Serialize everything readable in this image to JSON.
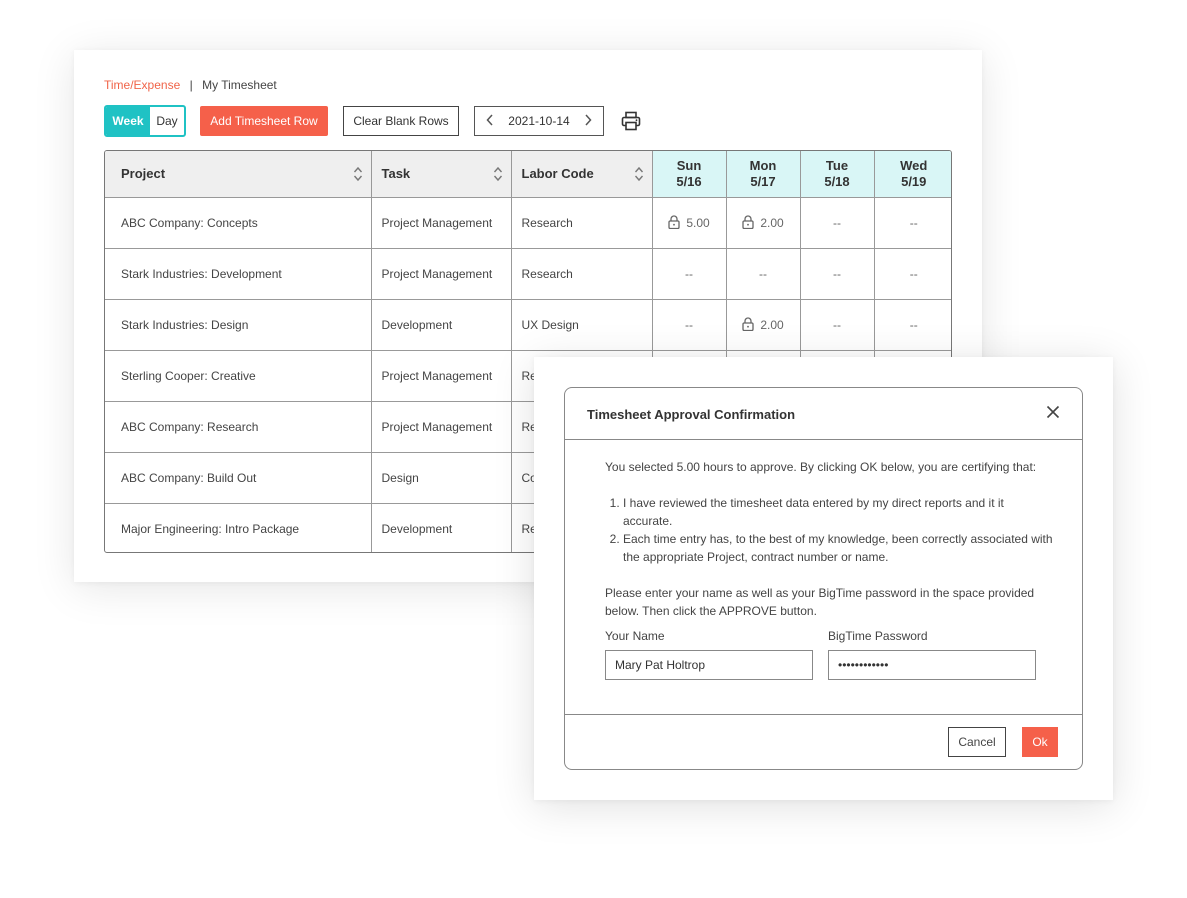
{
  "breadcrumb": {
    "link": "Time/Expense",
    "separator": "|",
    "current": "My Timesheet"
  },
  "toolbar": {
    "week_label": "Week",
    "day_label": "Day",
    "add_row_label": "Add Timesheet Row",
    "clear_blank_label": "Clear Blank Rows",
    "date_value": "2021-10-14",
    "prev_icon": "chevron-left-icon",
    "next_icon": "chevron-right-icon",
    "print_icon": "printer-icon"
  },
  "grid": {
    "columns": {
      "project": "Project",
      "task": "Task",
      "labor_code": "Labor Code",
      "days": [
        {
          "name": "Sun",
          "date": "5/16"
        },
        {
          "name": "Mon",
          "date": "5/17"
        },
        {
          "name": "Tue",
          "date": "5/18"
        },
        {
          "name": "Wed",
          "date": "5/19"
        }
      ]
    },
    "rows": [
      {
        "project": "ABC Company: Concepts",
        "task": "Project Management",
        "labor_code": "Research",
        "sun": "5.00",
        "sun_locked": true,
        "mon": "2.00",
        "mon_locked": true,
        "tue": "--",
        "wed": "--"
      },
      {
        "project": "Stark Industries: Development",
        "task": "Project Management",
        "labor_code": "Research",
        "sun": "--",
        "mon": "--",
        "tue": "--",
        "wed": "--"
      },
      {
        "project": "Stark Industries: Design",
        "task": "Development",
        "labor_code": "UX Design",
        "sun": "--",
        "mon": "2.00",
        "mon_locked": true,
        "tue": "--",
        "wed": "--"
      },
      {
        "project": "Sterling Cooper: Creative",
        "task": "Project Management",
        "labor_code": "Re"
      },
      {
        "project": "ABC Company: Research",
        "task": "Project Management",
        "labor_code": "Re"
      },
      {
        "project": "ABC Company: Build Out",
        "task": "Design",
        "labor_code": "Co"
      },
      {
        "project": "Major Engineering: Intro Package",
        "task": "Development",
        "labor_code": "Re"
      }
    ]
  },
  "modal": {
    "title": "Timesheet Approval Confirmation",
    "intro": "You selected 5.00 hours to approve. By clicking OK below, you are certifying that:",
    "items": [
      "I have reviewed the timesheet data entered by my direct reports and it it accurate.",
      "Each time entry has, to the best of my knowledge, been correctly associated with the appropriate Project, contract number or name."
    ],
    "instruction": "Please enter your name as well as your BigTime password in the space provided below. Then click the APPROVE button.",
    "name_label": "Your Name",
    "name_value": "Mary Pat Holtrop",
    "password_label": "BigTime Password",
    "password_value": "••••••••••••",
    "cancel_label": "Cancel",
    "ok_label": "Ok"
  },
  "colors": {
    "accent_teal": "#1fc2c4",
    "accent_coral": "#f5604a",
    "day_header_bg": "#d9f6f6"
  }
}
